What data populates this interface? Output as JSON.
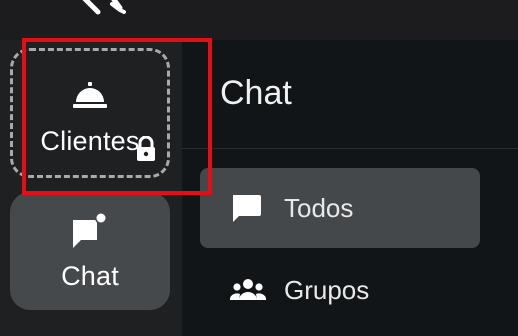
{
  "rail": {
    "items": [
      {
        "label": "Clientes",
        "icon": "service-bell-icon",
        "locked": true,
        "badge_icon": "lock-icon"
      },
      {
        "label": "Chat",
        "icon": "chat-notification-icon",
        "selected": true
      }
    ]
  },
  "panel": {
    "title": "Chat",
    "items": [
      {
        "label": "Todos",
        "icon": "chat-bubble-icon",
        "active": true
      },
      {
        "label": "Grupos",
        "icon": "group-icon",
        "active": false
      }
    ]
  },
  "colors": {
    "highlight": "#e50e15",
    "selected_bg": "#46494c",
    "panel_bg": "#121517",
    "rail_bg": "#1e2022"
  }
}
